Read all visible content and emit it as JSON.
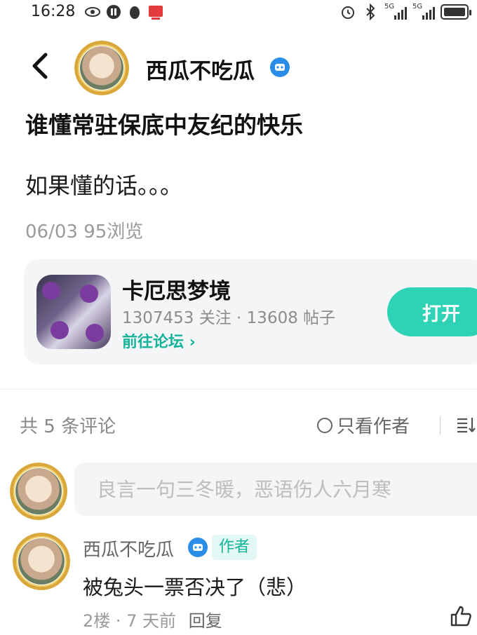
{
  "status_bar": {
    "time": "16:28",
    "signal1_label": "5G",
    "signal2_label": "5G"
  },
  "header": {
    "name": "西瓜不吃瓜"
  },
  "post": {
    "title": "谁懂常驻保底中友纪的快乐",
    "body": "如果懂的话。。。",
    "meta": "06/03  95浏览"
  },
  "forum": {
    "name": "卡厄思梦境",
    "stats": "1307453 关注 · 13608 帖子",
    "link": "前往论坛 ›",
    "open_label": "打开"
  },
  "comments_bar": {
    "count_label": "共 5 条评论",
    "author_only_label": "只看作者"
  },
  "comment_input": {
    "placeholder": "良言一句三冬暖，恶语伤人六月寒"
  },
  "comments": [
    {
      "name": "西瓜不吃瓜",
      "author_tag": "作者",
      "text": "被兔头一票否决了（悲）",
      "meta": "2楼 · 7 天前",
      "reply_label": "回复"
    }
  ],
  "colors": {
    "accent": "#2ed3b6",
    "link": "#15b39a",
    "verify_badge": "#2a8de8"
  }
}
